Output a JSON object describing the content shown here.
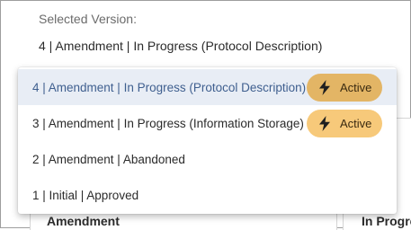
{
  "selected": {
    "label": "Selected Version:",
    "value": "4 | Amendment | In Progress (Protocol Description)"
  },
  "dropdown": {
    "options": [
      {
        "label": "4 | Amendment | In Progress (Protocol Description)",
        "badge": "Active",
        "selected": true
      },
      {
        "label": "3 | Amendment | In Progress (Information Storage)",
        "badge": "Active",
        "selected": false
      },
      {
        "label": "2 | Amendment | Abandoned",
        "badge": "",
        "selected": false
      },
      {
        "label": "1 | Initial | Approved",
        "badge": "",
        "selected": false
      }
    ]
  },
  "background_table": {
    "headers": [
      "Amendment",
      "In Progre"
    ]
  },
  "colors": {
    "selected_row_bg": "#e8edf5",
    "selected_text": "#3f5f8f",
    "badge_bg": "#f7c97a",
    "badge_bg_selected": "#e3b565"
  },
  "icons": {
    "badge_icon": "lightning-bolt-icon"
  }
}
